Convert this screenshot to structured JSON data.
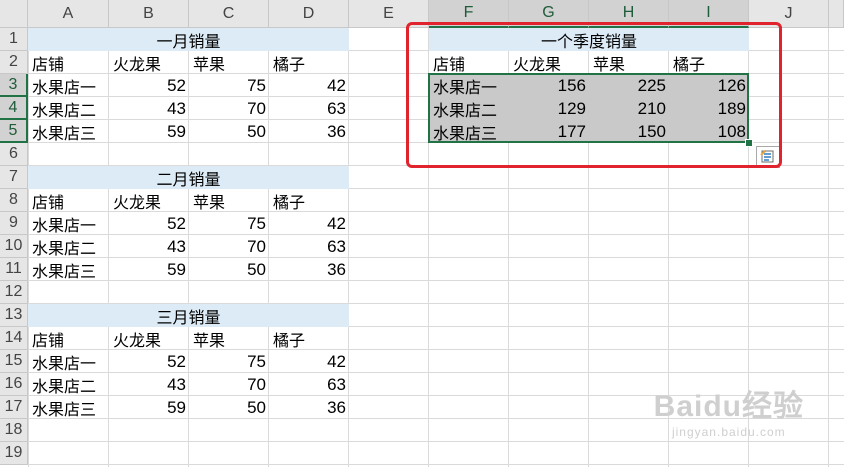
{
  "app": {
    "name": "Excel"
  },
  "columns": [
    "A",
    "B",
    "C",
    "D",
    "E",
    "F",
    "G",
    "H",
    "I",
    "J"
  ],
  "rows": [
    "1",
    "2",
    "3",
    "4",
    "5",
    "6",
    "7",
    "8",
    "9",
    "10",
    "11",
    "12",
    "13",
    "14",
    "15",
    "16",
    "17",
    "18",
    "19"
  ],
  "months": [
    {
      "title": "一月销量",
      "headers": [
        "店铺",
        "火龙果",
        "苹果",
        "橘子"
      ],
      "data": [
        {
          "shop": "水果店一",
          "values": [
            "52",
            "75",
            "42"
          ]
        },
        {
          "shop": "水果店二",
          "values": [
            "43",
            "70",
            "63"
          ]
        },
        {
          "shop": "水果店三",
          "values": [
            "59",
            "50",
            "36"
          ]
        }
      ]
    },
    {
      "title": "二月销量",
      "headers": [
        "店铺",
        "火龙果",
        "苹果",
        "橘子"
      ],
      "data": [
        {
          "shop": "水果店一",
          "values": [
            "52",
            "75",
            "42"
          ]
        },
        {
          "shop": "水果店二",
          "values": [
            "43",
            "70",
            "63"
          ]
        },
        {
          "shop": "水果店三",
          "values": [
            "59",
            "50",
            "36"
          ]
        }
      ]
    },
    {
      "title": "三月销量",
      "headers": [
        "店铺",
        "火龙果",
        "苹果",
        "橘子"
      ],
      "data": [
        {
          "shop": "水果店一",
          "values": [
            "52",
            "75",
            "42"
          ]
        },
        {
          "shop": "水果店二",
          "values": [
            "43",
            "70",
            "63"
          ]
        },
        {
          "shop": "水果店三",
          "values": [
            "59",
            "50",
            "36"
          ]
        }
      ]
    }
  ],
  "summary": {
    "title": "一个季度销量",
    "headers": [
      "店铺",
      "火龙果",
      "苹果",
      "橘子"
    ],
    "data": [
      {
        "shop": "水果店一",
        "values": [
          "156",
          "225",
          "126"
        ]
      },
      {
        "shop": "水果店二",
        "values": [
          "129",
          "210",
          "189"
        ]
      },
      {
        "shop": "水果店三",
        "values": [
          "177",
          "150",
          "108"
        ]
      }
    ]
  },
  "selection": {
    "columns": [
      "F",
      "G",
      "H",
      "I"
    ],
    "rows": [
      "3",
      "4",
      "5"
    ]
  },
  "watermark": {
    "brand": "Baidu经验",
    "url": "jingyan.baidu.com"
  },
  "colors": {
    "title_fill": "#ddebf7",
    "selection_fill": "#c9c9c9",
    "selection_border": "#217346",
    "annotation": "#e0232d"
  }
}
